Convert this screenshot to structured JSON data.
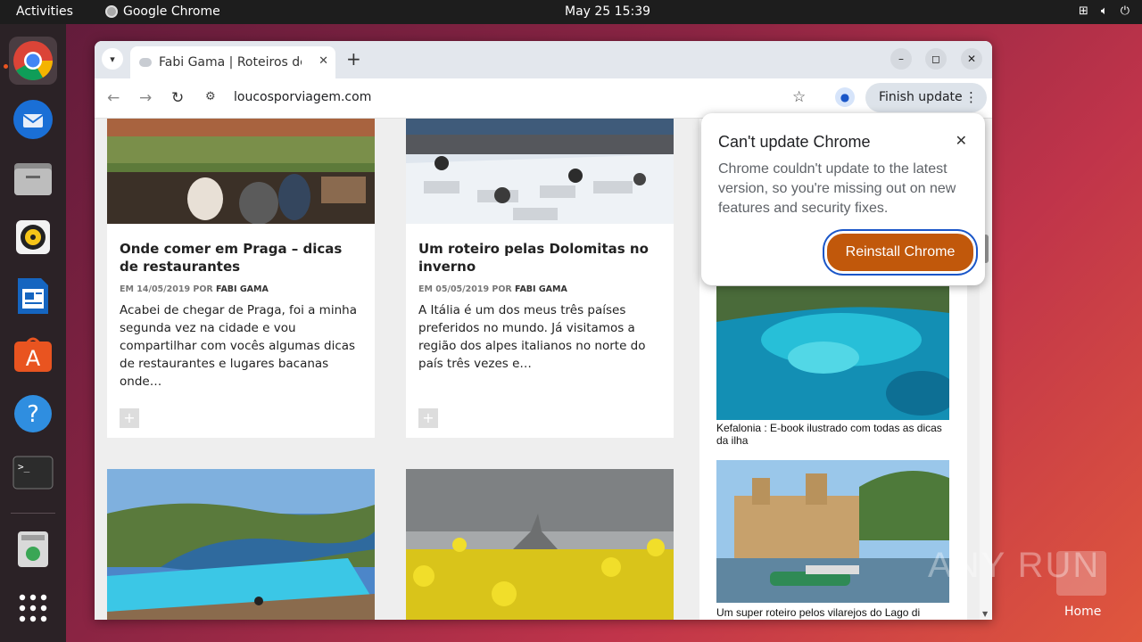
{
  "topbar": {
    "activities": "Activities",
    "app_name": "Google Chrome",
    "clock": "May 25  15:39"
  },
  "dock": {
    "items": [
      "chrome",
      "thunderbird",
      "files",
      "rhythmbox",
      "writer",
      "app-center",
      "help",
      "terminal",
      "trash",
      "show-apps"
    ]
  },
  "browser": {
    "tab_title": "Fabi Gama | Roteiros de V",
    "url": "loucosporviagem.com",
    "finish_update": "Finish update"
  },
  "articles": [
    {
      "title": "Onde comer em Praga – dicas de restaurantes",
      "meta_prefix": "EM 14/05/2019 POR",
      "author": "FABI GAMA",
      "excerpt": "Acabei de chegar de Praga, foi a minha segunda vez na cidade e vou compartilhar com vocês algumas dicas de restaurantes e lugares bacanas onde…"
    },
    {
      "title": "Um roteiro pelas Dolomitas no inverno",
      "meta_prefix": "EM 05/05/2019 POR",
      "author": "FABI GAMA",
      "excerpt": "A Itália é um dos meus três países preferidos no mundo. Já visitamos a região dos alpes italianos no norte do país três vezes e…"
    }
  ],
  "sidebar": {
    "caption1": "Kefalonia : E-book ilustrado com todas as dicas da ilha",
    "caption2": "Um super roteiro pelos vilarejos do Lago di"
  },
  "popup": {
    "title": "Can't update Chrome",
    "body": "Chrome couldn't update to the latest version, so you're missing out on new features and security fixes.",
    "button": "Reinstall Chrome"
  },
  "desktop": {
    "watermark": "ANY RUN",
    "home_label": "Home"
  },
  "colors": {
    "accent": "#c1580b",
    "focus_ring": "#1a56c8",
    "ubuntu_orange": "#e95420"
  }
}
